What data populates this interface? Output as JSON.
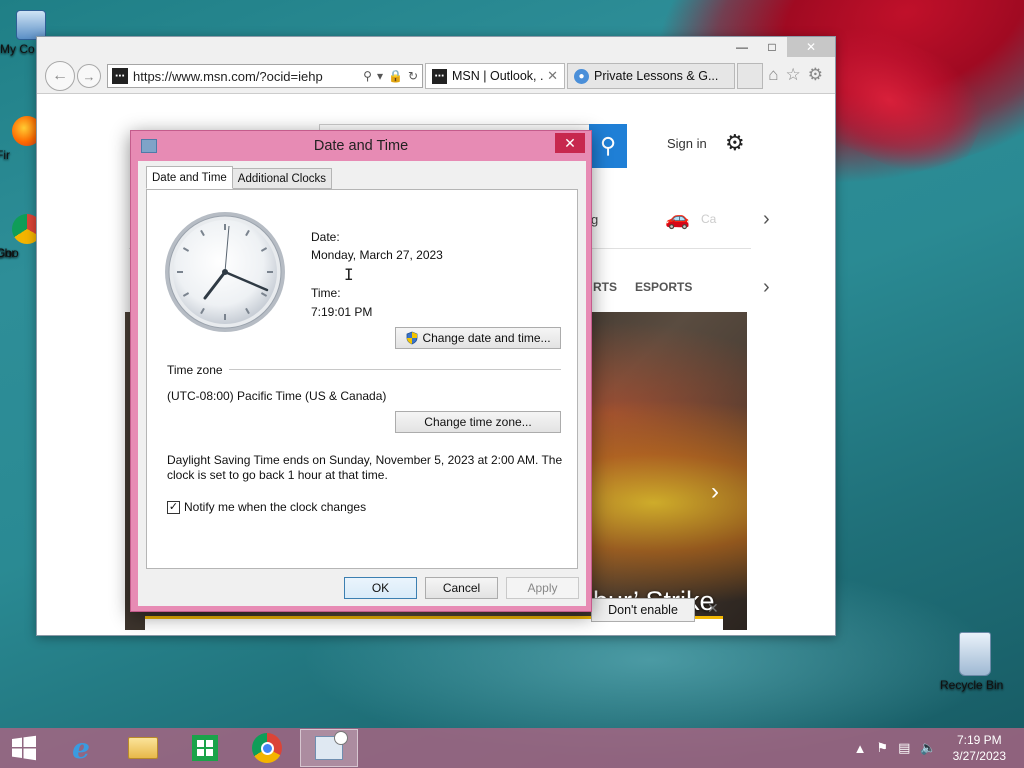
{
  "desktop": {
    "icons": [
      {
        "label": "My Co"
      },
      {
        "label": "Fir"
      },
      {
        "label": "Goo"
      },
      {
        "label": "Chr"
      },
      {
        "label": "Recycle Bin"
      }
    ]
  },
  "browser": {
    "address": "https://www.msn.com/?ocid=iehp",
    "tabs": [
      {
        "title": "MSN | Outlook, ...",
        "active": true
      },
      {
        "title": "Private Lessons & G...",
        "active": false
      }
    ],
    "page": {
      "sign_in": "Sign in",
      "weather_fragment": "Ca",
      "nav_fragment_g": "g",
      "nav_sports_fragment": "RTS",
      "nav_esports": "ESPORTS",
      "hero_headline_fragment": "bur’ Strike",
      "notify_button": "Don't enable"
    }
  },
  "dialog": {
    "title": "Date and Time",
    "tabs": [
      "Date and Time",
      "Additional Clocks"
    ],
    "date_label": "Date:",
    "date_value": "Monday, March 27, 2023",
    "time_label": "Time:",
    "time_value": "7:19:01 PM",
    "change_datetime_button": "Change date and time...",
    "timezone_header": "Time zone",
    "timezone_value": "(UTC-08:00) Pacific Time (US & Canada)",
    "change_timezone_button": "Change time zone...",
    "dst_line1": "Daylight Saving Time ends on Sunday, November 5, 2023 at 2:00 AM. The",
    "dst_line2": "clock is set to go back 1 hour at that time.",
    "notify_checkbox_label": "Notify me when the clock changes",
    "notify_checked": true,
    "ok_button": "OK",
    "cancel_button": "Cancel",
    "apply_button": "Apply"
  },
  "taskbar": {
    "time": "7:19 PM",
    "date": "3/27/2023"
  },
  "colors": {
    "dialog_frame": "#e78bb4",
    "taskbar": "#aa6482",
    "msn_search_blue": "#1f7fd6"
  }
}
